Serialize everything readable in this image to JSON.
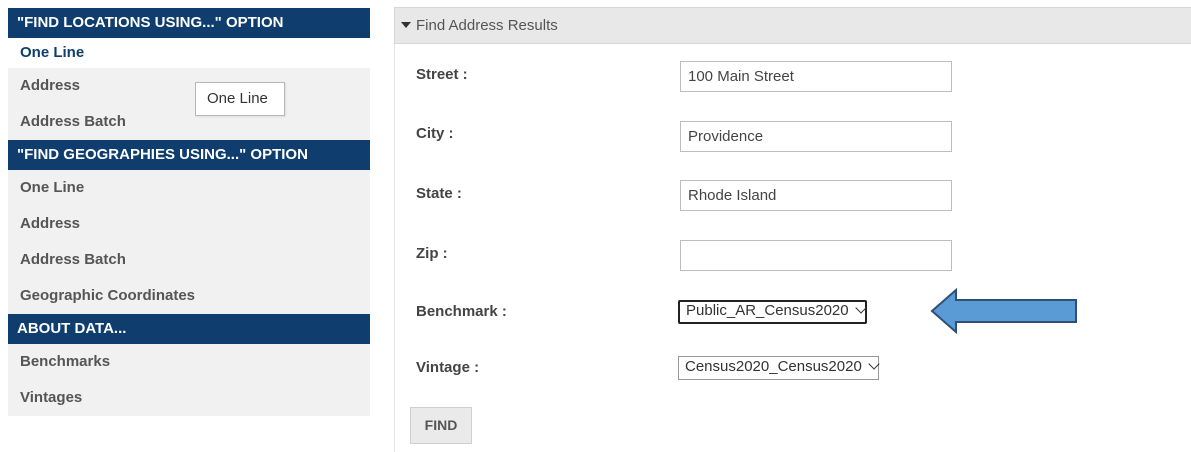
{
  "sidebar": {
    "sections": [
      {
        "header": "\"FIND LOCATIONS USING...\" OPTION",
        "items": [
          "One Line",
          "Address",
          "Address Batch"
        ]
      },
      {
        "header": "\"FIND GEOGRAPHIES USING...\" OPTION",
        "items": [
          "One Line",
          "Address",
          "Address Batch",
          "Geographic Coordinates"
        ]
      },
      {
        "header": "ABOUT DATA...",
        "items": [
          "Benchmarks",
          "Vintages"
        ]
      }
    ],
    "tooltip": "One Line"
  },
  "panel": {
    "header": "Find Address Results"
  },
  "form": {
    "street_label": "Street :",
    "street_value": "100 Main Street",
    "city_label": "City :",
    "city_value": "Providence",
    "state_label": "State :",
    "state_value": "Rhode Island",
    "zip_label": "Zip :",
    "zip_value": "",
    "benchmark_label": "Benchmark :",
    "benchmark_value": "Public_AR_Census2020",
    "vintage_label": "Vintage :",
    "vintage_value": "Census2020_Census2020",
    "find_label": "FIND"
  },
  "colors": {
    "header_bg": "#0f3e6e",
    "arrow_fill": "#5b9bd5",
    "arrow_stroke": "#2e4f7a"
  }
}
